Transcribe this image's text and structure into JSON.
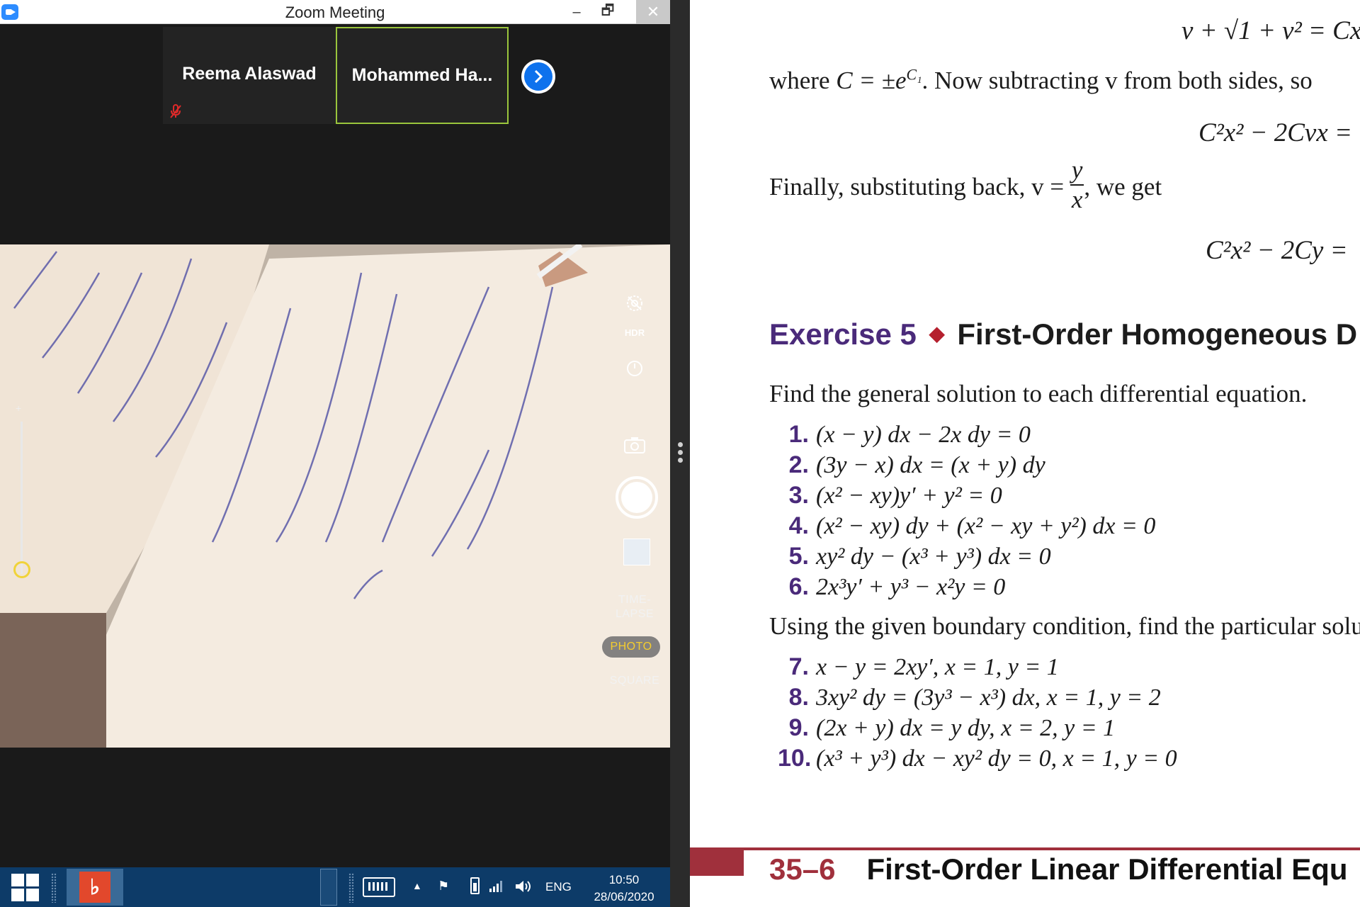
{
  "zoom_window": {
    "title": "Zoom Meeting",
    "minimize": "–",
    "restore": "🗗",
    "close": "✕",
    "participants": [
      {
        "name": "Reema Alaswad",
        "muted": true
      },
      {
        "name": "Mohammed  Ha...",
        "active_speaker": true
      }
    ],
    "camera_modes": {
      "hdr": "HDR",
      "timelapse_line1": "TIME-",
      "timelapse_line2": "LAPSE",
      "photo": "PHOTO",
      "square": "SQUARE"
    },
    "accent_active_border": "#9ac53c",
    "accent_button": "#0e72ed"
  },
  "taskbar": {
    "language": "ENG",
    "time": "10:50",
    "date": "28/06/2020"
  },
  "textbook": {
    "eq_top": "v + √1 + v² = Cx",
    "where_line_prefix": "where ",
    "where_line_math": "C = ±e",
    "where_line_sup": "C₁",
    "where_line_suffix": ". Now subtracting v from both sides, so",
    "eq_second": "C²x² − 2Cvx =",
    "finally_prefix": "Finally, substituting back, v = ",
    "finally_num": "y",
    "finally_den": "x",
    "finally_suffix": ", we get",
    "eq_third": "C²x² − 2Cy =",
    "exercise_number": "Exercise 5",
    "exercise_title": "First-Order Homogeneous D",
    "instruction_general": "Find the general solution to each differential equation.",
    "problems_general": [
      {
        "n": "1.",
        "eq": "(x − y) dx − 2x dy = 0"
      },
      {
        "n": "2.",
        "eq": "(3y − x) dx = (x + y) dy"
      },
      {
        "n": "3.",
        "eq": "(x² − xy)y′ + y² = 0"
      },
      {
        "n": "4.",
        "eq": "(x² − xy) dy + (x² − xy + y²) dx = 0"
      },
      {
        "n": "5.",
        "eq": "xy² dy − (x³ + y³) dx = 0"
      },
      {
        "n": "6.",
        "eq": "2x³y′ + y³ − x²y = 0"
      }
    ],
    "instruction_particular": "Using the given boundary condition, find the particular solu",
    "problems_particular": [
      {
        "n": "7.",
        "eq": "x − y = 2xy′,    x = 1, y = 1"
      },
      {
        "n": "8.",
        "eq": "3xy² dy = (3y³ − x³) dx,    x = 1, y = 2"
      },
      {
        "n": "9.",
        "eq": "(2x + y) dx = y dy,    x = 2, y = 1"
      },
      {
        "n": "10.",
        "eq": "(x³ + y³) dx − xy² dy = 0,    x = 1, y = 0"
      }
    ],
    "section_number": "35–6",
    "section_title": "First-Order Linear Differential Equ",
    "accent_purple": "#4a2a7a",
    "accent_red": "#a0303c"
  }
}
